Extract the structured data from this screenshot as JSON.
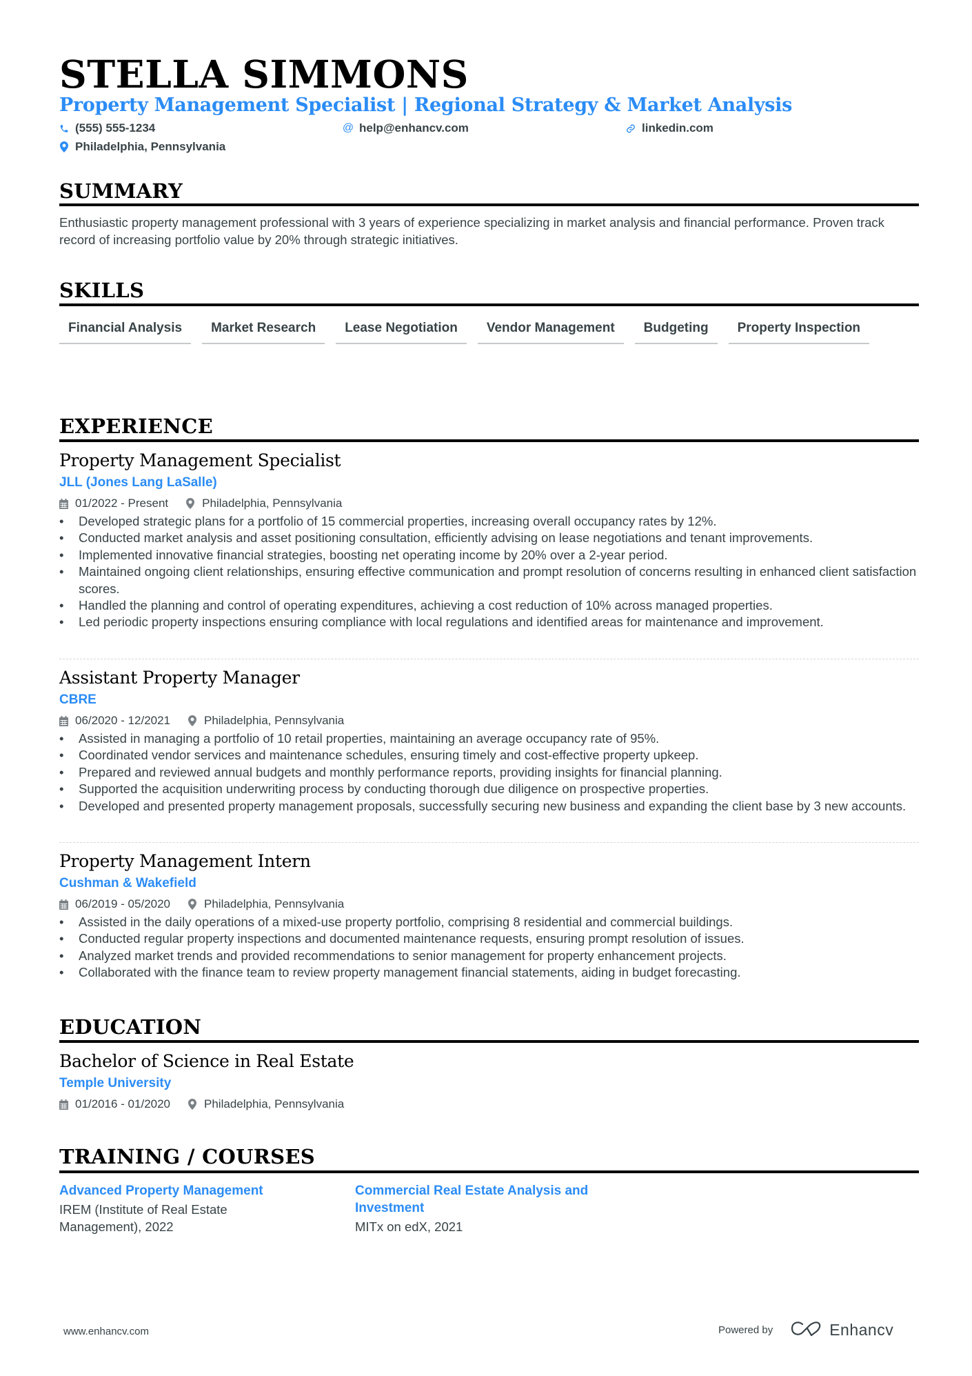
{
  "header": {
    "name": "STELLA SIMMONS",
    "subtitle": "Property Management Specialist | Regional Strategy & Market Analysis",
    "contacts": {
      "phone": "(555) 555-1234",
      "email": "help@enhancv.com",
      "link": "linkedin.com",
      "location": "Philadelphia, Pennsylvania"
    },
    "icons": {
      "phone": "phone-icon",
      "email": "at-icon",
      "link": "link-icon",
      "location": "map-pin-icon"
    },
    "accent_color": "#2b8cf5"
  },
  "sections": {
    "summary": "SUMMARY",
    "skills": "SKILLS",
    "experience": "EXPERIENCE",
    "education": "EDUCATION",
    "training": "TRAINING / COURSES"
  },
  "summary": {
    "text": "Enthusiastic property management professional with 3 years of experience specializing in market analysis and financial performance. Proven track record of increasing portfolio value by 20% through strategic initiatives."
  },
  "skills": [
    "Financial Analysis",
    "Market Research",
    "Lease Negotiation",
    "Vendor Management",
    "Budgeting",
    "Property Inspection"
  ],
  "experience": [
    {
      "title": "Property Management Specialist",
      "company": "JLL (Jones Lang LaSalle)",
      "dates": "01/2022 - Present",
      "location": "Philadelphia, Pennsylvania",
      "bullets": [
        "Developed strategic plans for a portfolio of 15 commercial properties, increasing overall occupancy rates by 12%.",
        "Conducted market analysis and asset positioning consultation, efficiently advising on lease negotiations and tenant improvements.",
        "Implemented innovative financial strategies, boosting net operating income by 20% over a 2-year period.",
        "Maintained ongoing client relationships, ensuring effective communication and prompt resolution of concerns resulting in enhanced client satisfaction scores.",
        "Handled the planning and control of operating expenditures, achieving a cost reduction of 10% across managed properties.",
        "Led periodic property inspections ensuring compliance with local regulations and identified areas for maintenance and improvement."
      ]
    },
    {
      "title": "Assistant Property Manager",
      "company": "CBRE",
      "dates": "06/2020 - 12/2021",
      "location": "Philadelphia, Pennsylvania",
      "bullets": [
        "Assisted in managing a portfolio of 10 retail properties, maintaining an average occupancy rate of 95%.",
        "Coordinated vendor services and maintenance schedules, ensuring timely and cost-effective property upkeep.",
        "Prepared and reviewed annual budgets and monthly performance reports, providing insights for financial planning.",
        "Supported the acquisition underwriting process by conducting thorough due diligence on prospective properties.",
        "Developed and presented property management proposals, successfully securing new business and expanding the client base by 3 new accounts."
      ]
    },
    {
      "title": "Property Management Intern",
      "company": "Cushman & Wakefield",
      "dates": "06/2019 - 05/2020",
      "location": "Philadelphia, Pennsylvania",
      "bullets": [
        "Assisted in the daily operations of a mixed-use property portfolio, comprising 8 residential and commercial buildings.",
        "Conducted regular property inspections and documented maintenance requests, ensuring prompt resolution of issues.",
        "Analyzed market trends and provided recommendations to senior management for property enhancement projects.",
        "Collaborated with the finance team to review property management financial statements, aiding in budget forecasting."
      ]
    }
  ],
  "education": [
    {
      "degree": "Bachelor of Science in Real Estate",
      "school": "Temple University",
      "dates": "01/2016 - 01/2020",
      "location": "Philadelphia, Pennsylvania"
    }
  ],
  "training": [
    {
      "title": "Advanced Property Management",
      "org": "IREM (Institute of Real Estate Management), 2022"
    },
    {
      "title": "Commercial Real Estate Analysis and Investment",
      "org": "MITx on edX, 2021"
    }
  ],
  "footer": {
    "website": "www.enhancv.com",
    "powered_by": "Powered by",
    "brand": "Enhancv"
  }
}
